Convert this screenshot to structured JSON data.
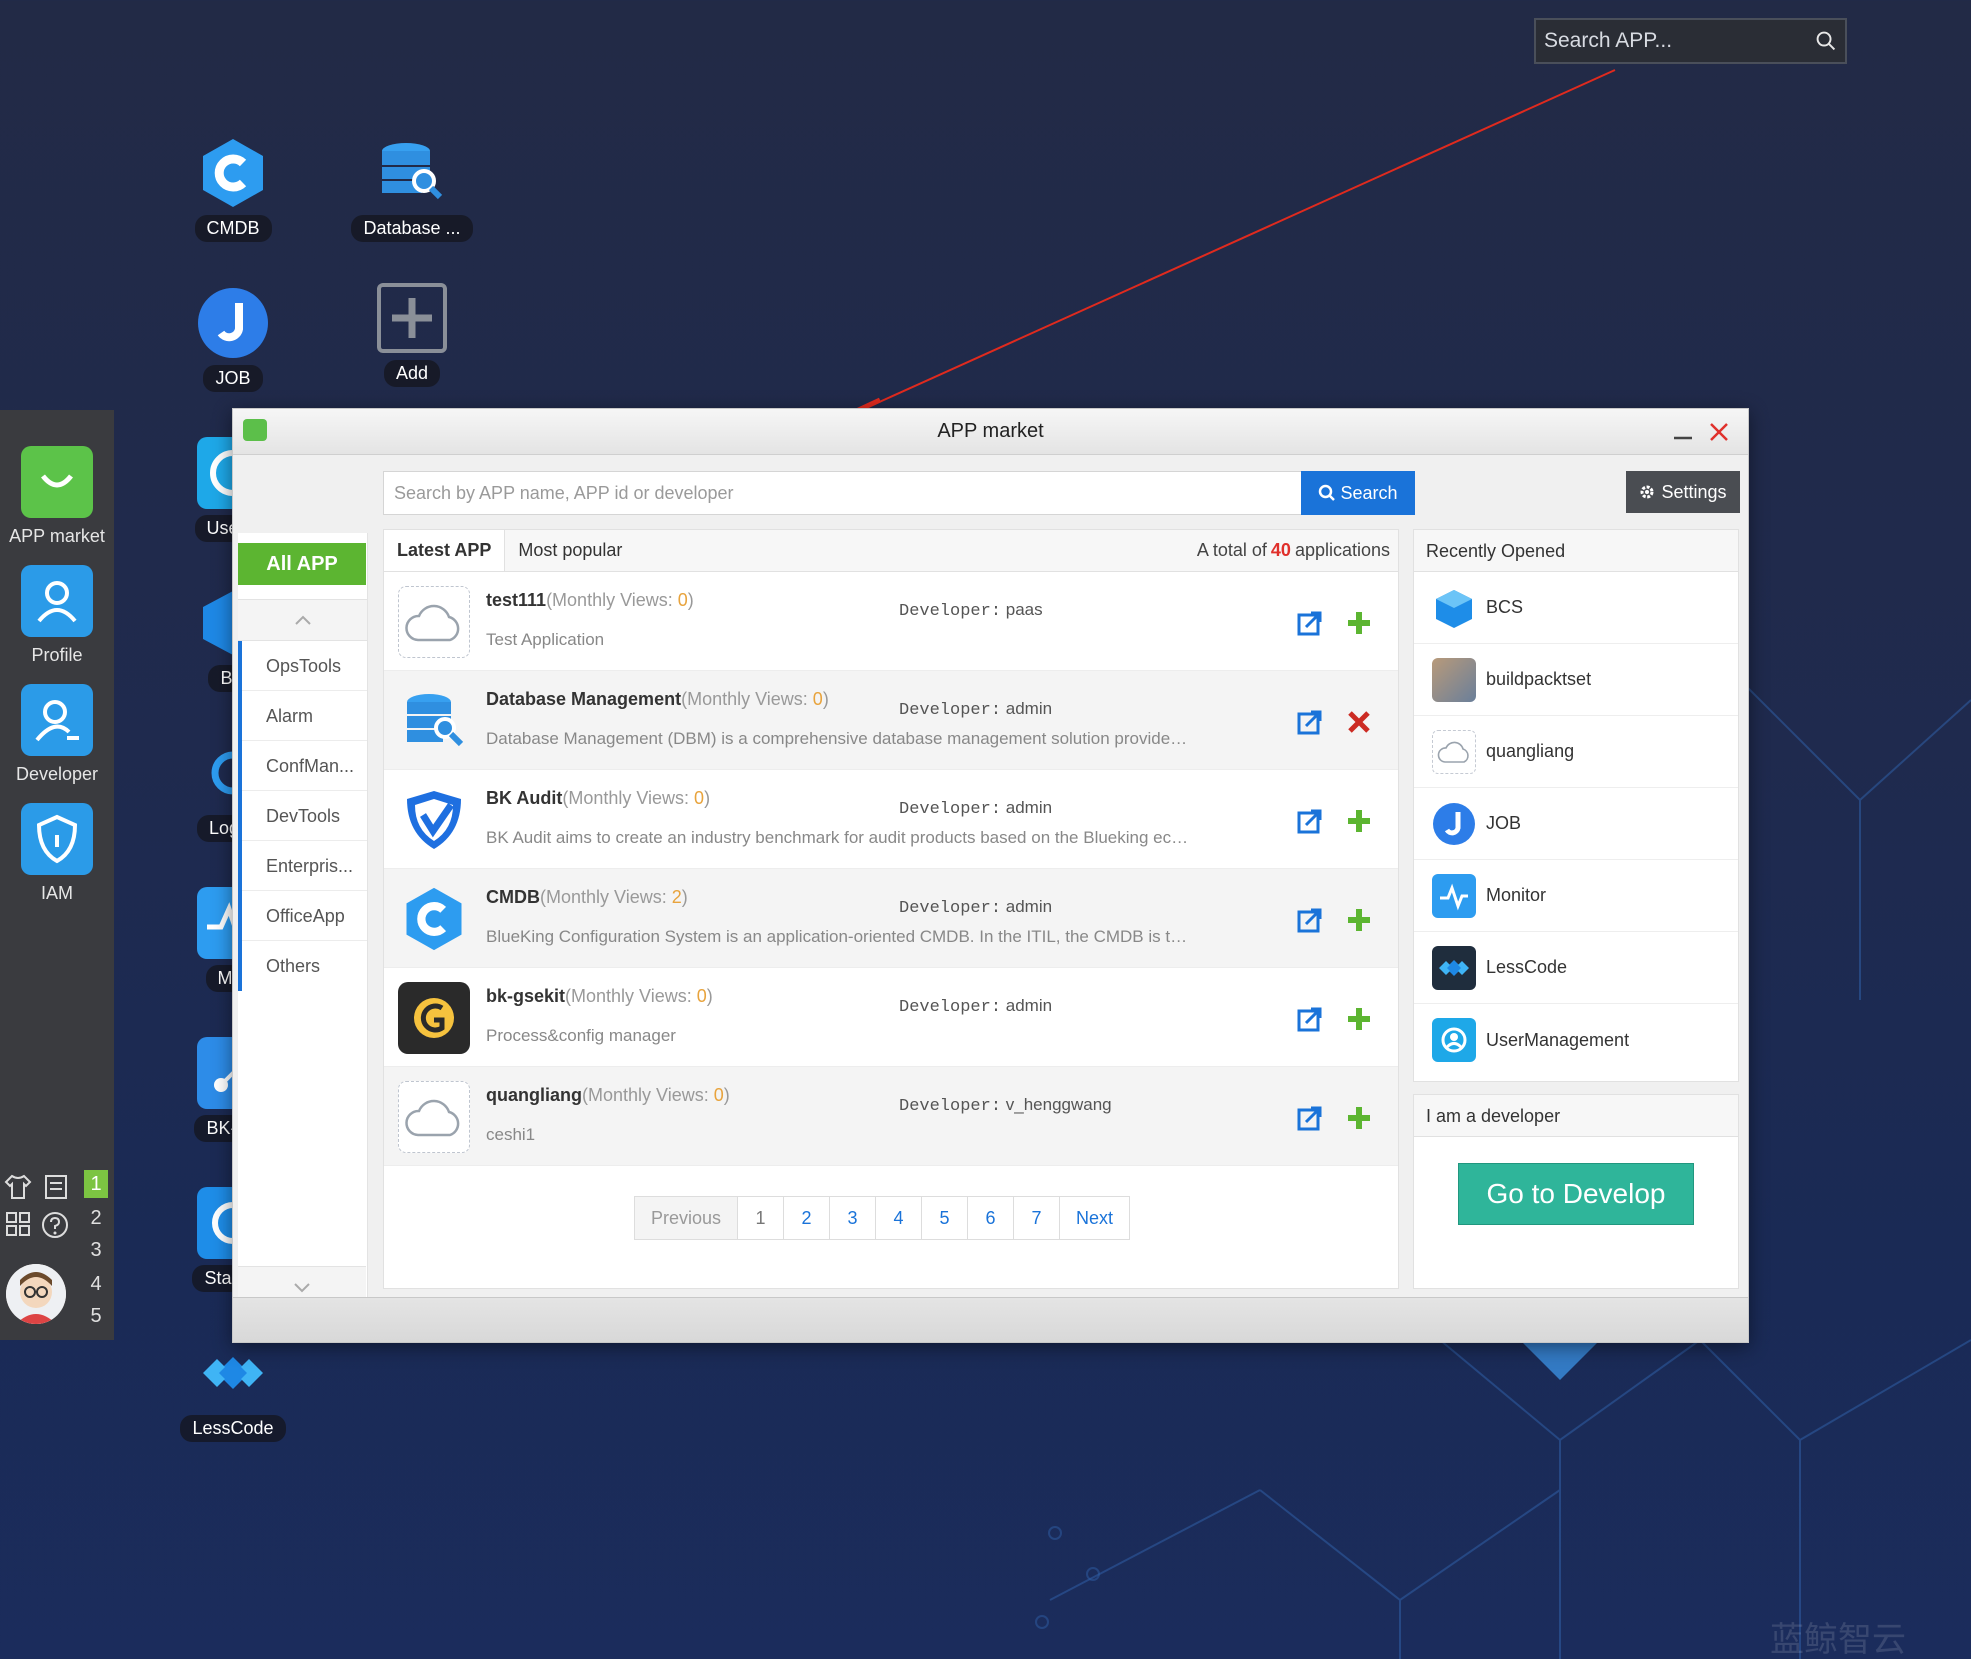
{
  "top_search": {
    "placeholder": "Search APP..."
  },
  "desktop_icons": [
    {
      "label": "CMDB"
    },
    {
      "label": "Database ..."
    },
    {
      "label": "JOB"
    },
    {
      "label": "Add"
    },
    {
      "label": "UserM"
    },
    {
      "label": "BC"
    },
    {
      "label": "Log-S"
    },
    {
      "label": "Mor"
    },
    {
      "label": "BK-No"
    },
    {
      "label": "Standa"
    },
    {
      "label": "LessCode"
    }
  ],
  "dock": {
    "items": [
      {
        "label": "APP market"
      },
      {
        "label": "Profile"
      },
      {
        "label": "Developer"
      },
      {
        "label": "IAM"
      }
    ],
    "workspaces": [
      "1",
      "2",
      "3",
      "4",
      "5"
    ]
  },
  "market": {
    "title": "APP market",
    "search_placeholder": "Search by APP name, APP id or developer",
    "search_button": "Search",
    "settings_button": "Settings",
    "all_app": "All APP",
    "categories": [
      "OpsTools",
      "Alarm",
      "ConfMan...",
      "DevTools",
      "Enterpris...",
      "OfficeApp",
      "Others"
    ],
    "tabs": [
      "Latest APP",
      "Most popular"
    ],
    "total": {
      "prefix": "A total of",
      "count": "40",
      "suffix": "applications"
    },
    "views_label": "(Monthly Views: ",
    "views_close": ")",
    "dev_label": "Developer:",
    "apps": [
      {
        "name": "test111",
        "views": "0",
        "developer": "paas",
        "desc": "Test Application",
        "action": "add"
      },
      {
        "name": "Database Management",
        "views": "0",
        "developer": "admin",
        "desc": "Database Management (DBM) is a comprehensive database management solution provide…",
        "action": "remove"
      },
      {
        "name": "BK Audit",
        "views": "0",
        "developer": "admin",
        "desc": "BK Audit aims to create an industry benchmark for audit products based on the Blueking ec…",
        "action": "add"
      },
      {
        "name": "CMDB",
        "views": "2",
        "developer": "admin",
        "desc": "BlueKing Configuration System is an application-oriented CMDB. In the ITIL, the CMDB is t…",
        "action": "add"
      },
      {
        "name": "bk-gsekit",
        "views": "0",
        "developer": "admin",
        "desc": "Process&config manager",
        "action": "add"
      },
      {
        "name": "quangliang",
        "views": "0",
        "developer": "v_henggwang",
        "desc": "ceshi1",
        "action": "add"
      }
    ],
    "pagination": [
      "Previous",
      "1",
      "2",
      "3",
      "4",
      "5",
      "6",
      "7",
      "Next"
    ],
    "recent_title": "Recently Opened",
    "recent": [
      "BCS",
      "buildpacktset",
      "quangliang",
      "JOB",
      "Monitor",
      "LessCode",
      "UserManagement"
    ],
    "dev_title": "I am a developer",
    "go_develop": "Go to Develop"
  },
  "watermark": "蓝鲸智云",
  "colors": {
    "accent_blue": "#1a73d9",
    "green": "#5cb531",
    "remove_red": "#cc2b23",
    "teal": "#2fb59a"
  }
}
